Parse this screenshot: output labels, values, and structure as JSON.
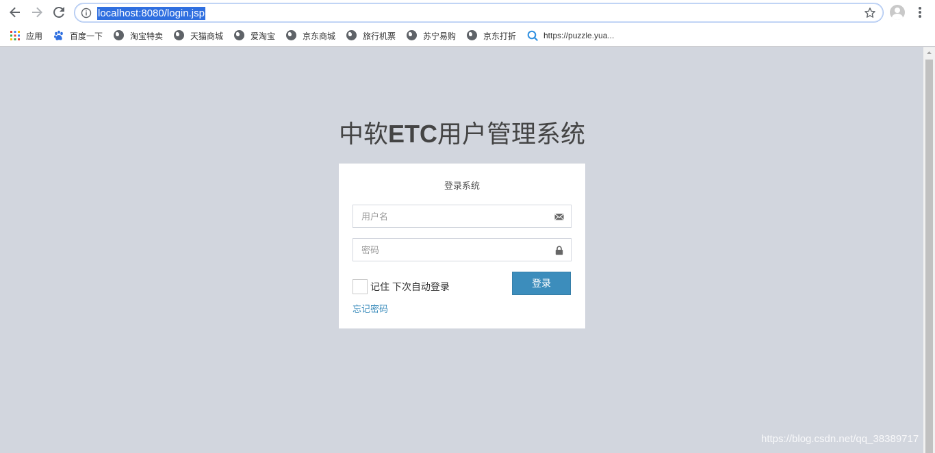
{
  "browser": {
    "url": "localhost:8080/login.jsp",
    "bookmarks": [
      {
        "label": "应用",
        "icon": "apps-grid-icon"
      },
      {
        "label": "百度一下",
        "icon": "baidu-paw-icon"
      },
      {
        "label": "淘宝特卖",
        "icon": "globe-icon"
      },
      {
        "label": "天猫商城",
        "icon": "globe-icon"
      },
      {
        "label": "爱淘宝",
        "icon": "globe-icon"
      },
      {
        "label": "京东商城",
        "icon": "globe-icon"
      },
      {
        "label": "旅行机票",
        "icon": "globe-icon"
      },
      {
        "label": "苏宁易购",
        "icon": "globe-icon"
      },
      {
        "label": "京东打折",
        "icon": "globe-icon"
      },
      {
        "label": "https://puzzle.yua...",
        "icon": "search-magnifier-icon"
      }
    ]
  },
  "page": {
    "title_prefix": "中软",
    "title_bold": "ETC",
    "title_suffix": "用户管理系统",
    "box_msg": "登录系统",
    "username_placeholder": "用户名",
    "password_placeholder": "密码",
    "remember_label": "记住 下次自动登录",
    "login_button": "登录",
    "forgot_link": "忘记密码",
    "accent_color": "#3c8dbc",
    "background_color": "#d2d6de"
  },
  "watermark": "https://blog.csdn.net/qq_38389717"
}
